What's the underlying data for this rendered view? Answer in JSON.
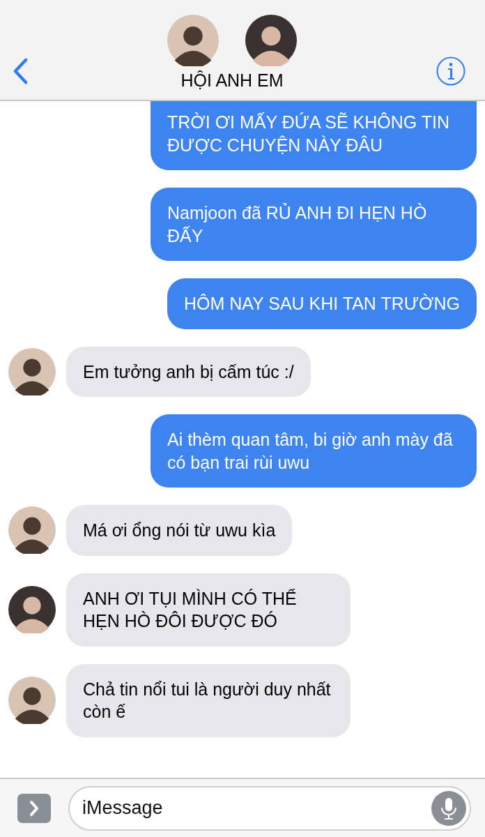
{
  "header": {
    "participants": [
      {
        "color": "#d9c4b4"
      },
      {
        "color": "#3a3230"
      }
    ],
    "title": "HỘI ANH EM"
  },
  "messages": [
    {
      "kind": "sent",
      "text": "TRỜI ƠI MẤY ĐỨA SẼ KHÔNG TIN ĐƯỢC CHUYỆN NÀY ĐÂU"
    },
    {
      "kind": "sent",
      "text": "Namjoon đã RỦ ANH ĐI HẸN HÒ ĐẤY"
    },
    {
      "kind": "sent",
      "text": "HÔM NAY SAU KHI TAN TRƯỜNG"
    },
    {
      "kind": "received",
      "color": "#d9c4b4",
      "text": "Em tưởng anh bị cấm túc :/"
    },
    {
      "kind": "sent",
      "text": "Ai thèm quan tâm, bi giờ anh mày đã có bạn trai rùi uwu"
    },
    {
      "kind": "received",
      "color": "#d9c4b4",
      "text": "Má ơi ổng nói từ uwu kìa"
    },
    {
      "kind": "received",
      "color": "#3a3230",
      "text": "ANH ƠI TỤI MÌNH CÓ THỂ HẸN HÒ ĐÔI ĐƯỢC ĐÓ"
    },
    {
      "kind": "received",
      "color": "#d9c4b4",
      "text": "Chả tin nổi tui là người duy nhất còn ế"
    }
  ],
  "composer": {
    "placeholder": "iMessage"
  }
}
